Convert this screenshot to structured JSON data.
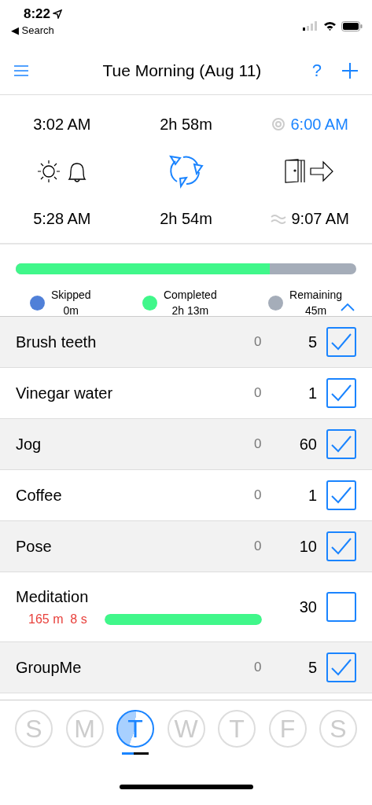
{
  "status_bar": {
    "time": "8:22",
    "back_label": "◀ Search"
  },
  "nav": {
    "title": "Tue Morning (Aug 11)",
    "help": "?"
  },
  "summary": {
    "start": "3:02 AM",
    "duration_top": "2h 58m",
    "target": "6:00 AM",
    "wake": "5:28 AM",
    "duration_bottom": "2h 54m",
    "leave": "9:07 AM"
  },
  "progress": {
    "level": 0.746,
    "legend": [
      {
        "label": "Skipped",
        "value": "0m",
        "color": "#5080d8"
      },
      {
        "label": "Completed",
        "value": "2h 13m",
        "color": "#40f78a"
      },
      {
        "label": "Remaining",
        "value": "45m",
        "color": "#a5adb9"
      }
    ]
  },
  "tasks": [
    {
      "kind": "plain",
      "name": "Brush teeth",
      "skipped": "0",
      "minutes": "5",
      "checked": true
    },
    {
      "kind": "plain",
      "name": "Vinegar water",
      "skipped": "0",
      "minutes": "1",
      "checked": true
    },
    {
      "kind": "plain",
      "name": "Jog",
      "skipped": "0",
      "minutes": "60",
      "checked": true
    },
    {
      "kind": "plain",
      "name": "Coffee",
      "skipped": "0",
      "minutes": "1",
      "checked": true
    },
    {
      "kind": "plain",
      "name": "Pose",
      "skipped": "0",
      "minutes": "10",
      "checked": true
    },
    {
      "kind": "timer",
      "name": "Meditation",
      "timer": "165 m  8 s",
      "level": 1,
      "minutes": "30",
      "checked": false
    },
    {
      "kind": "plain",
      "name": "GroupMe",
      "skipped": "0",
      "minutes": "5",
      "checked": true
    }
  ],
  "days": [
    {
      "letter": "S",
      "selected": false
    },
    {
      "letter": "M",
      "selected": false
    },
    {
      "letter": "T",
      "selected": true,
      "level": 0.45
    },
    {
      "letter": "W",
      "selected": false
    },
    {
      "letter": "T",
      "selected": false
    },
    {
      "letter": "F",
      "selected": false
    },
    {
      "letter": "S",
      "selected": false
    }
  ]
}
